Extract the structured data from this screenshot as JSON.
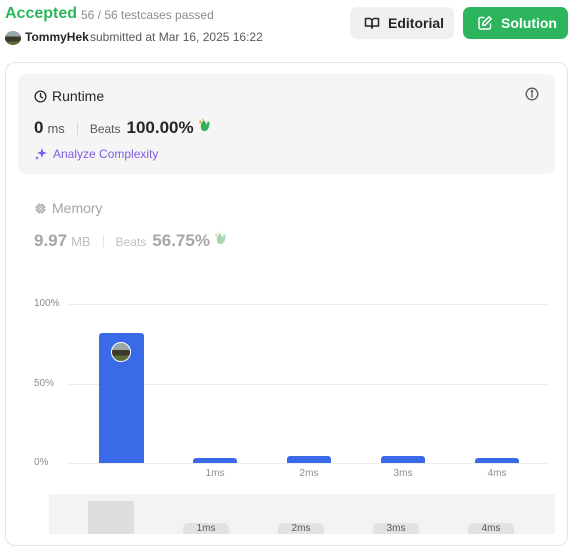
{
  "header": {
    "status": "Accepted",
    "testcases": "56 / 56 testcases passed",
    "author": "TommyHek",
    "submitted": "submitted at Mar 16, 2025 16:22",
    "editorial_label": "Editorial",
    "solution_label": "Solution"
  },
  "runtime": {
    "title": "Runtime",
    "value": "0",
    "unit": "ms",
    "beats_label": "Beats",
    "beats": "100.00%",
    "analyze_label": "Analyze Complexity"
  },
  "memory": {
    "title": "Memory",
    "value": "9.97",
    "unit": "MB",
    "beats_label": "Beats",
    "beats": "56.75%"
  },
  "colors": {
    "accent_green": "#2db55d",
    "bar_blue": "#3a6ae8",
    "analyze_purple": "#7c5ce4"
  },
  "chart_data": {
    "type": "bar",
    "categories": [
      "",
      "1ms",
      "2ms",
      "3ms",
      "4ms"
    ],
    "values": [
      82,
      3,
      4.5,
      4.5,
      3
    ],
    "y_ticks": [
      "100%",
      "50%",
      "0%"
    ],
    "ylim": [
      0,
      100
    ],
    "grid": true,
    "brush_labels": [
      "1ms",
      "2ms",
      "3ms",
      "4ms"
    ]
  }
}
